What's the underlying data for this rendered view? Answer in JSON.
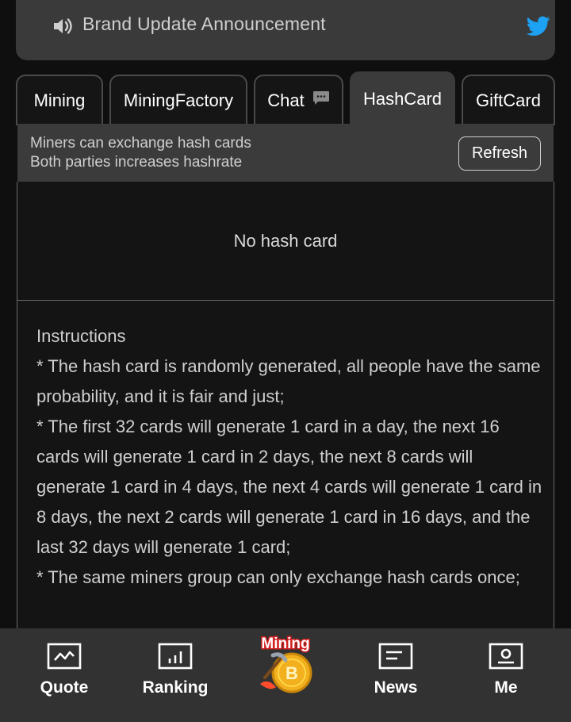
{
  "announcement": {
    "title": "Brand Update Announcement"
  },
  "tabs": [
    {
      "label": "Mining"
    },
    {
      "label": "MiningFactory"
    },
    {
      "label": "Chat"
    },
    {
      "label": "HashCard"
    },
    {
      "label": "GiftCard"
    }
  ],
  "active_tab": "HashCard",
  "subheader": {
    "line1": "Miners can exchange hash cards",
    "line2": "Both parties increases hashrate",
    "refresh_label": "Refresh"
  },
  "empty_state": "No hash card",
  "instructions": {
    "heading": "Instructions",
    "items": [
      "* The hash card is randomly generated, all people have the same probability, and it is fair and just;",
      "* The first 32 cards will generate 1 card in a day, the next 16 cards will generate 1 card in 2 days, the next 8 cards will generate 1 card in 4 days, the next 4 cards will generate 1 card in 8 days, the next 2 cards will generate 1 card in 16 days, and the last 32 days will generate 1 card;",
      "* The same miners group can only exchange hash cards once;"
    ]
  },
  "bottom_nav": {
    "items": [
      {
        "label": "Quote",
        "icon": "quote-icon"
      },
      {
        "label": "Ranking",
        "icon": "ranking-icon"
      },
      {
        "label": "",
        "icon": "mining-logo"
      },
      {
        "label": "News",
        "icon": "news-icon"
      },
      {
        "label": "Me",
        "icon": "profile-icon"
      }
    ],
    "center_logo_text": "Mining"
  },
  "colors": {
    "background": "#0f0f0f",
    "banner": "#3a3a3a",
    "active_tab": "#3b3b3b",
    "twitter_blue": "#1da1f2",
    "nav_bar": "#323232"
  }
}
